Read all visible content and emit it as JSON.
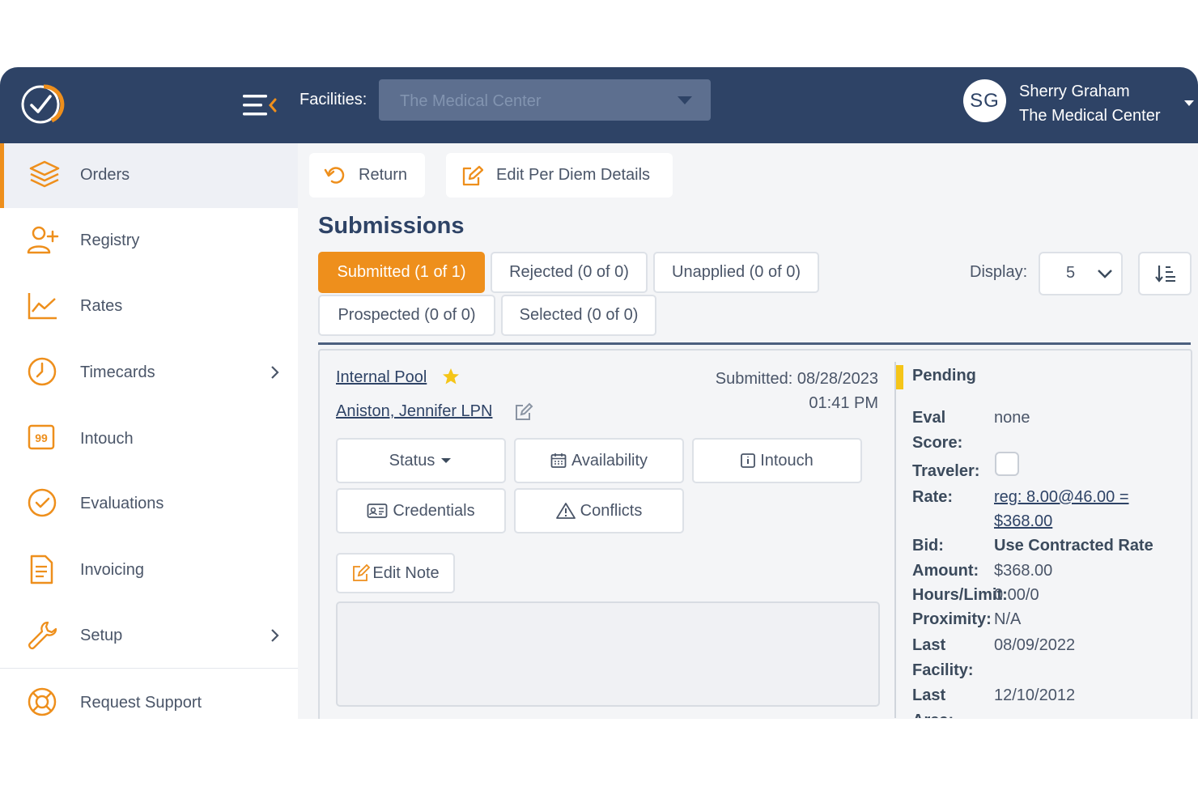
{
  "header": {
    "facilities_label": "Facilities:",
    "facility_value": "The Medical Center",
    "user": {
      "initials": "SG",
      "name": "Sherry Graham",
      "facility": "The Medical Center"
    }
  },
  "colors": {
    "navy": "#2e4366",
    "accent": "#ee8f1c",
    "pending": "#f5c518"
  },
  "sidebar": {
    "items": [
      {
        "label": "Orders",
        "icon": "layers-icon",
        "active": true
      },
      {
        "label": "Registry",
        "icon": "user-plus-icon"
      },
      {
        "label": "Rates",
        "icon": "line-chart-icon"
      },
      {
        "label": "Timecards",
        "icon": "clock-icon",
        "expandable": true
      },
      {
        "label": "Intouch",
        "icon": "quote-icon"
      },
      {
        "label": "Evaluations",
        "icon": "check-circle-icon"
      },
      {
        "label": "Invoicing",
        "icon": "document-icon"
      },
      {
        "label": "Setup",
        "icon": "wrench-icon",
        "expandable": true
      },
      {
        "label": "Request Support",
        "icon": "lifebuoy-icon"
      }
    ]
  },
  "toolbar": {
    "return_label": "Return",
    "edit_label": "Edit Per Diem Details"
  },
  "submissions": {
    "title": "Submissions",
    "filters": {
      "submitted": "Submitted (1 of 1)",
      "rejected": "Rejected (0 of 0)",
      "unapplied": "Unapplied (0 of 0)",
      "prospected": "Prospected (0 of 0)",
      "selected": "Selected (0 of 0)"
    },
    "display_label": "Display:",
    "display_value": "5"
  },
  "card": {
    "pool": "Internal Pool",
    "candidate": "Aniston, Jennifer LPN",
    "submitted_line1": "Submitted: 08/28/2023",
    "submitted_line2": "01:41 PM",
    "buttons": {
      "status": "Status",
      "availability": "Availability",
      "intouch": "Intouch",
      "credentials": "Credentials",
      "conflicts": "Conflicts",
      "edit_note": "Edit Note"
    },
    "info": {
      "status": "Pending",
      "eval_label_1": "Eval",
      "eval_label_2": "Score:",
      "eval_value": "none",
      "traveler_label": "Traveler:",
      "rate_label": "Rate:",
      "rate_value_1": "reg: 8.00@46.00 =",
      "rate_value_2": "$368.00",
      "bid_label": "Bid:",
      "bid_value": "Use Contracted Rate",
      "amount_label": "Amount:",
      "amount_value": "$368.00",
      "hours_label": "Hours/Limit:",
      "hours_value": "0.00/0",
      "proximity_label": "Proximity:",
      "proximity_value": "N/A",
      "last_facility_label_1": "Last",
      "last_facility_label_2": "Facility:",
      "last_facility_value": "08/09/2022",
      "last_area_label_1": "Last",
      "last_area_label_2": "Area:",
      "last_area_value": "12/10/2012"
    }
  }
}
